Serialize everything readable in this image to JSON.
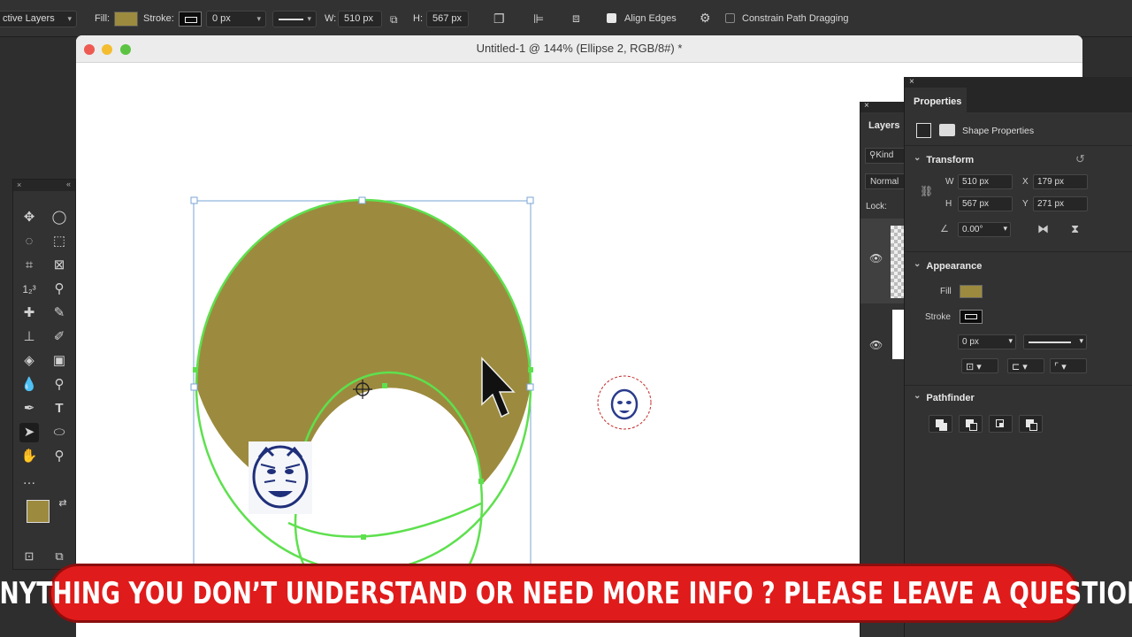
{
  "options_bar": {
    "layers_dropdown": "ctive Layers",
    "fill_label": "Fill:",
    "stroke_label": "Stroke:",
    "stroke_width": "0 px",
    "w_label": "W:",
    "w_value": "510 px",
    "h_label": "H:",
    "h_value": "567 px",
    "align_edges_label": "Align Edges",
    "constrain_label": "Constrain Path Dragging",
    "fill_color": "#9c8b3e"
  },
  "document": {
    "title": "Untitled-1 @ 144% (Ellipse 2, RGB/8#) *"
  },
  "layers_panel": {
    "tab_label": "Layers",
    "kind_label": "Kind",
    "blend_mode": "Normal",
    "lock_label": "Lock:"
  },
  "properties_panel": {
    "tab_label": "Properties",
    "shape_properties_label": "Shape Properties",
    "transform": {
      "title": "Transform",
      "w_label": "W",
      "w_value": "510 px",
      "x_label": "X",
      "x_value": "179 px",
      "h_label": "H",
      "h_value": "567 px",
      "y_label": "Y",
      "y_value": "271 px",
      "angle_value": "0.00°"
    },
    "appearance": {
      "title": "Appearance",
      "fill_label": "Fill",
      "stroke_label": "Stroke",
      "stroke_width": "0 px"
    },
    "pathfinder": {
      "title": "Pathfinder"
    }
  },
  "banner_text": "ANYTHING YOU DON’T UNDERSTAND OR NEED MORE INFO ? PLEASE LEAVE A QUESTION",
  "colors": {
    "accent_fill": "#9c8b3e",
    "path_highlight": "#5ee04e",
    "banner_red": "#e01b1b"
  }
}
